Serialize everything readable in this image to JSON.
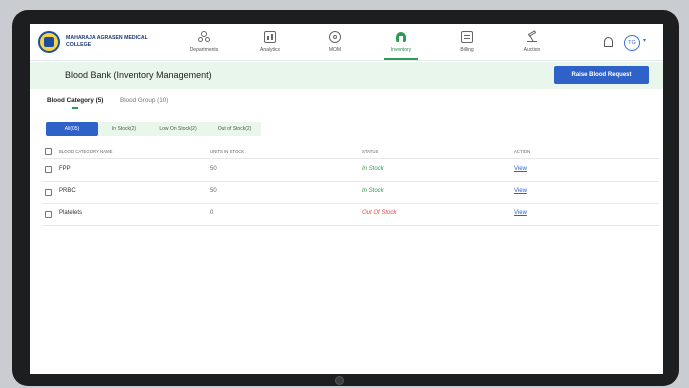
{
  "college_name": "MAHARAJA AGRASEN MEDICAL COLLEGE",
  "nav": [
    {
      "label": "Departments",
      "icon": "departments-icon"
    },
    {
      "label": "Analytics",
      "icon": "analytics-icon"
    },
    {
      "label": "MOM",
      "icon": "mom-icon"
    },
    {
      "label": "Inventory",
      "icon": "inventory-icon",
      "active": true
    },
    {
      "label": "Billing",
      "icon": "billing-icon"
    },
    {
      "label": "Auction",
      "icon": "auction-icon"
    }
  ],
  "user_initials": "TG",
  "banner": {
    "title": "Blood Bank (Inventory Management)",
    "raise_button": "Raise Blood Request"
  },
  "tabs": [
    "Blood Category (5)",
    "Blood Group (10)"
  ],
  "filters": [
    "All(05)",
    "In Stock(2)",
    "Low On Stock(2)",
    "Out of Stock(2)"
  ],
  "table": {
    "headers": [
      "BLOOD CATEGORY NAME",
      "UNITS IN STOCK",
      "STATUS",
      "ACTION"
    ],
    "rows": [
      {
        "name": "FPP",
        "units": "50",
        "status": "In Stock",
        "action": "View"
      },
      {
        "name": "PRBC",
        "units": "50",
        "status": "In Stock",
        "action": "View"
      },
      {
        "name": "Platelets",
        "units": "0",
        "status": "Out Of Stock",
        "action": "View"
      }
    ]
  },
  "colors": {
    "accent_blue": "#2f62c9",
    "accent_green": "#2e9b55",
    "banner_bg": "#e8f6ec",
    "out_of_stock": "#e04848"
  }
}
